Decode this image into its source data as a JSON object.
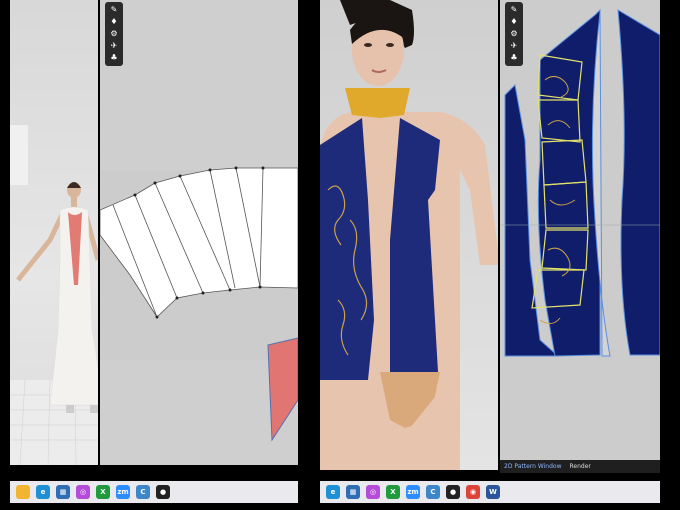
{
  "left_pattern_toolbar": {
    "icons": [
      "pen-icon",
      "shirt-icon",
      "gear-icon",
      "bird-icon",
      "shirt-icon"
    ]
  },
  "right_pattern_toolbar": {
    "icons": [
      "pen-icon",
      "shirt-icon",
      "gear-icon",
      "bird-icon",
      "shirt-icon"
    ]
  },
  "right_window_tabs": {
    "tab1": "2D Pattern Window",
    "tab2": "Render"
  },
  "taskbar_left": {
    "icons": [
      {
        "name": "file-explorer-icon",
        "glyph": "",
        "color": "#f2b531"
      },
      {
        "name": "edge-icon",
        "glyph": "e",
        "color": "#1f8fd6"
      },
      {
        "name": "store-icon",
        "glyph": "▦",
        "color": "#2f6db5"
      },
      {
        "name": "app-icon",
        "glyph": "◎",
        "color": "#b44cd9"
      },
      {
        "name": "xbox-icon",
        "glyph": "X",
        "color": "#1f9a3c"
      },
      {
        "name": "zoom-icon",
        "glyph": "zm",
        "color": "#2d8cff"
      },
      {
        "name": "clo-icon",
        "glyph": "C",
        "color": "#3d86c7"
      },
      {
        "name": "record-icon",
        "glyph": "●",
        "color": "#222"
      }
    ]
  },
  "taskbar_right": {
    "icons": [
      {
        "name": "edge-icon",
        "glyph": "e",
        "color": "#1f8fd6"
      },
      {
        "name": "store-icon",
        "glyph": "▦",
        "color": "#2f6db5"
      },
      {
        "name": "app-icon",
        "glyph": "◎",
        "color": "#b44cd9"
      },
      {
        "name": "xbox-icon",
        "glyph": "X",
        "color": "#1f9a3c"
      },
      {
        "name": "zoom-icon",
        "glyph": "zm",
        "color": "#2d8cff"
      },
      {
        "name": "clo-icon",
        "glyph": "C",
        "color": "#3d86c7"
      },
      {
        "name": "record-icon",
        "glyph": "●",
        "color": "#222"
      },
      {
        "name": "chrome-icon",
        "glyph": "◉",
        "color": "#db4437"
      },
      {
        "name": "word-icon",
        "glyph": "W",
        "color": "#2b579a"
      }
    ]
  }
}
